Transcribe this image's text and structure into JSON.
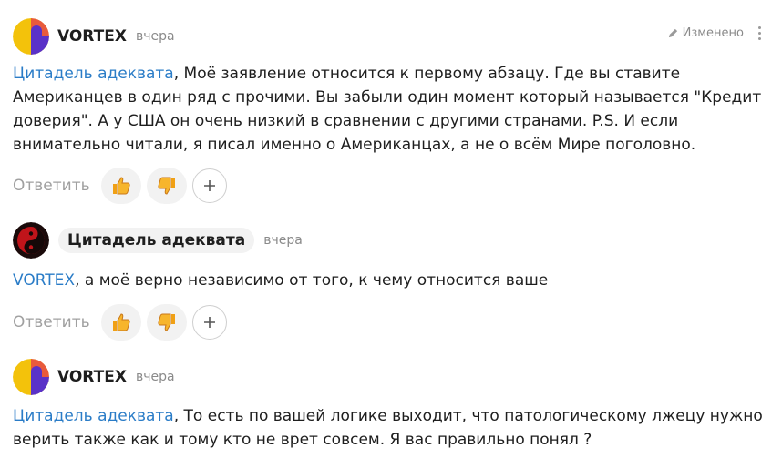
{
  "labels": {
    "reply": "Ответить",
    "edited": "Изменено"
  },
  "comments": [
    {
      "author": "VORTEX",
      "time": "вчера",
      "mention": "Цитадель адеквата",
      "text": ", Моё заявление относится к первому абзацу. Где вы ставите Американцев в один ряд с прочими. Вы забыли один момент который называется \"Кредит доверия\". А у США он очень низкий в сравнении с другими странами. P.S. И если внимательно читали, я писал именно о Американцах, а не о всём Мире поголовно."
    },
    {
      "author": "Цитадель адеквата",
      "time": "вчера",
      "mention": "VORTEX",
      "text": ", а моё верно независимо от того, к чему относится ваше"
    },
    {
      "author": "VORTEX",
      "time": "вчера",
      "mention": "Цитадель адеквата",
      "text": ", То есть по вашей логике выходит, что патологическому лжецу нужно верить также как и тому кто не врет совсем. Я вас правильно понял ?"
    }
  ],
  "colors": {
    "link": "#2a7cc7",
    "muted": "#8a8a8a",
    "pill": "#f2f2f2"
  },
  "icons": [
    "pencil-icon",
    "more-vertical-icon",
    "thumbs-up-icon",
    "thumbs-down-icon",
    "plus-icon",
    "yin-yang-avatar-icon"
  ]
}
